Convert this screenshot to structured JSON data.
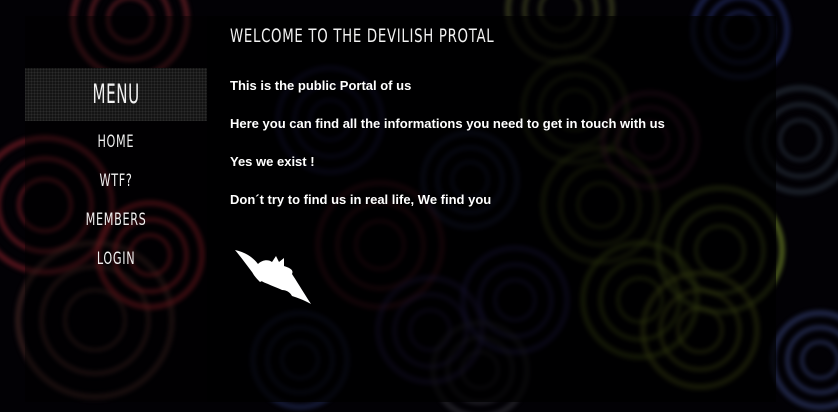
{
  "sidebar": {
    "menu_title": "MENU",
    "items": [
      {
        "label": "HOME"
      },
      {
        "label": "WTF?"
      },
      {
        "label": "MEMBERS"
      },
      {
        "label": "LOGIN"
      }
    ]
  },
  "main": {
    "title": "WELCOME TO THE DEVILISH PROTAL",
    "paragraphs": [
      "This is the public Portal of us",
      "Here you can find all the informations you need to get in touch with us",
      "Yes we exist !",
      "Don´t try to find us in real life, We find you"
    ]
  },
  "colors": {
    "background": "#020105",
    "text": "#ffffff",
    "menu_header_bg": "#141414"
  },
  "icons": {
    "bat": "bat-icon"
  }
}
